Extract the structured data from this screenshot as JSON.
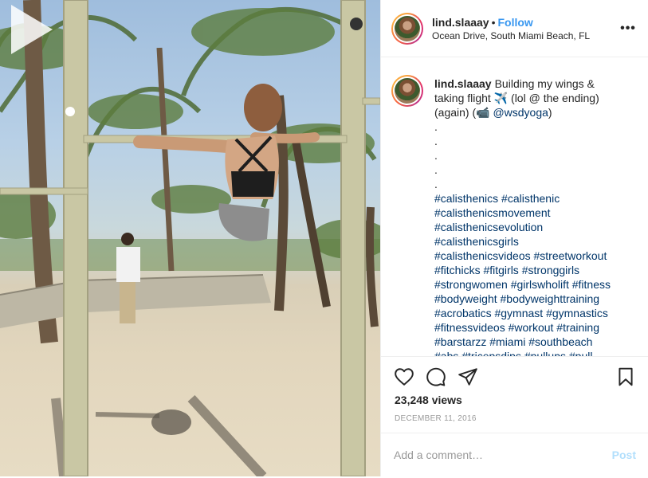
{
  "header": {
    "username": "lind.slaaay",
    "separator": "•",
    "follow_label": "Follow",
    "location": "Ocean Drive, South Miami Beach, FL",
    "more_icon": "more-options-icon",
    "more_label": "•••"
  },
  "caption": {
    "username": "lind.slaaay",
    "text_1": "Building my wings &",
    "text_2": "taking flight ✈️ (lol @ the ending)",
    "text_3": "(again) (📹",
    "mention": "@wsdyoga",
    "text_3_end": ")",
    "dots": [
      ".",
      ".",
      ".",
      ".",
      "."
    ],
    "hashtag_lines": [
      "#calisthenics #calisthenic",
      "#calisthenicsmovement",
      "#calisthenicsevolution",
      "#calisthenicsgirls",
      "#calisthenicsvideos #streetworkout",
      "#fitchicks #fitgirls #stronggirls",
      "#strongwomen #girlswholift #fitness",
      "#bodyweight #bodyweighttraining",
      "#acrobatics #gymnast #gymnastics",
      "#fitnessvideos #workout #training",
      "#barstarzz #miami #southbeach",
      "#abs #tricepsdips #pullups #pull"
    ]
  },
  "actions": {
    "like_icon": "heart-icon",
    "comment_icon": "comment-icon",
    "share_icon": "share-icon",
    "save_icon": "bookmark-icon",
    "views": "23,248 views",
    "date": "DECEMBER 11, 2016"
  },
  "comment_box": {
    "placeholder": "Add a comment…",
    "post_label": "Post"
  },
  "media": {
    "play_icon": "play-icon"
  },
  "colors": {
    "link": "#3897f0",
    "hashtag": "#003569",
    "muted": "#999999",
    "post_disabled": "#b2dffc"
  }
}
